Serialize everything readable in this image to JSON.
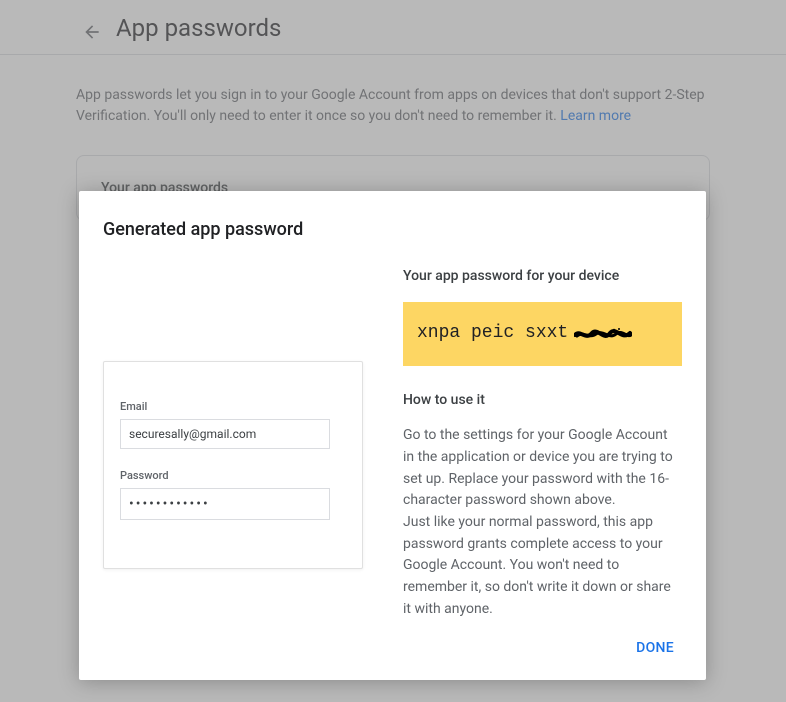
{
  "header": {
    "title": "App passwords"
  },
  "description": {
    "text": "App passwords let you sign in to your Google Account from apps on devices that don't support 2-Step Verification. You'll only need to enter it once so you don't need to remember it. ",
    "learn_more": "Learn more"
  },
  "card": {
    "title": "Your app passwords"
  },
  "modal": {
    "title": "Generated app password",
    "device_heading": "Your app password for your device",
    "generated_password_visible": "xnpa peic sxxt",
    "preview": {
      "email_label": "Email",
      "email_value": "securesally@gmail.com",
      "password_label": "Password",
      "password_value": "••••••••••••"
    },
    "how_heading": "How to use it",
    "how_text_1": "Go to the settings for your Google Account in the application or device you are trying to set up. Replace your password with the 16-character password shown above.",
    "how_text_2": "Just like your normal password, this app password grants complete access to your Google Account. You won't need to remember it, so don't write it down or share it with anyone.",
    "done_label": "DONE"
  }
}
